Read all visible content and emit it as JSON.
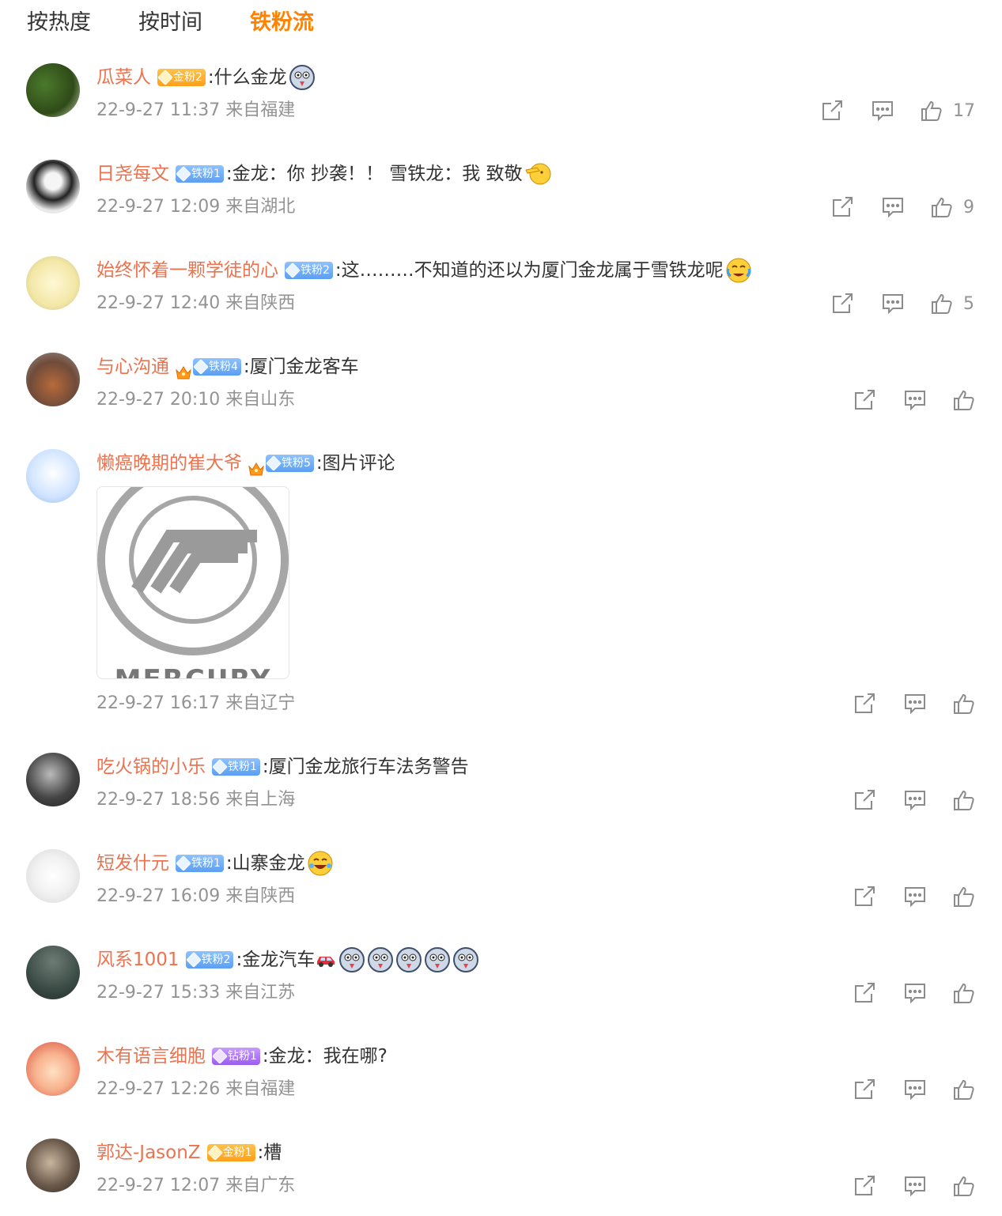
{
  "tabs": [
    "按热度",
    "按时间",
    "铁粉流"
  ],
  "comments": [
    {
      "user": "瓜菜人",
      "badge": "金粉2",
      "badge_type": "gold",
      "text": ":什么金龙",
      "emojis": 1,
      "emoji_kind": "dog",
      "time": "22-9-27 11:37 来自福建",
      "likes": "17"
    },
    {
      "user": "日尧每文",
      "badge": "铁粉1",
      "badge_type": "iron",
      "text": ":金龙：你 抄袭！！ 雪铁龙：我 致敬",
      "emojis": 1,
      "emoji_kind": "salute",
      "time": "22-9-27 12:09 来自湖北",
      "likes": "9"
    },
    {
      "user": "始终怀着一颗学徒的心",
      "badge": "铁粉2",
      "badge_type": "iron",
      "text": ":这………不知道的还以为厦门金龙属于雪铁龙呢",
      "emojis": 1,
      "emoji_kind": "cry",
      "time": "22-9-27 12:40 来自陕西",
      "likes": "5"
    },
    {
      "user": "与心沟通",
      "badge": "铁粉4",
      "badge_type": "iron",
      "crown": true,
      "text": ":厦门金龙客车",
      "emojis": 0,
      "time": "22-9-27 20:10 来自山东",
      "likes": ""
    },
    {
      "user": "懒癌晚期的崔大爷",
      "badge": "铁粉5",
      "badge_type": "iron",
      "crown": true,
      "text": ":图片评论",
      "emojis": 0,
      "image_caption": "MERCURY",
      "time": "22-9-27 16:17 来自辽宁",
      "likes": ""
    },
    {
      "user": "吃火锅的小乐",
      "badge": "铁粉1",
      "badge_type": "iron",
      "text": ":厦门金龙旅行车法务警告",
      "emojis": 0,
      "time": "22-9-27 18:56 来自上海",
      "likes": ""
    },
    {
      "user": "短发什元",
      "badge": "铁粉1",
      "badge_type": "iron",
      "text": ":山寨金龙",
      "emojis": 1,
      "emoji_kind": "laugh",
      "time": "22-9-27 16:09 来自陕西",
      "likes": ""
    },
    {
      "user": "风系1001",
      "badge": "铁粉2",
      "badge_type": "iron",
      "text": ":金龙汽车",
      "emojis": 5,
      "emoji_kind": "dog",
      "car": true,
      "time": "22-9-27 15:33 来自江苏",
      "likes": ""
    },
    {
      "user": "木有语言细胞",
      "badge": "钻粉1",
      "badge_type": "diamond",
      "text": ":金龙：我在哪?",
      "emojis": 0,
      "time": "22-9-27 12:26 来自福建",
      "likes": ""
    },
    {
      "user": "郭达-JasonZ",
      "badge": "金粉1",
      "badge_type": "gold",
      "text": ":槽",
      "emojis": 0,
      "time": "22-9-27 12:07 来自广东",
      "likes": ""
    }
  ],
  "colors": {
    "accent": "#ff8200",
    "username": "#eb7350",
    "meta": "#939393"
  },
  "icons": [
    "share-icon",
    "comment-icon",
    "like-icon"
  ]
}
